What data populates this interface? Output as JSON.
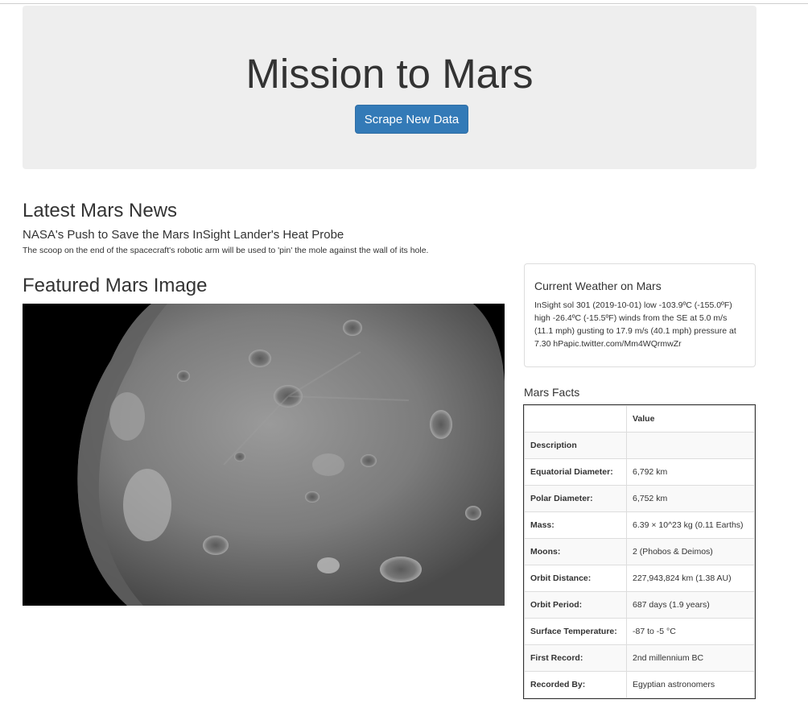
{
  "jumbotron": {
    "title": "Mission to Mars",
    "button_label": "Scrape New Data",
    "button_color": "#337ab7"
  },
  "news": {
    "heading": "Latest Mars News",
    "title": "NASA's Push to Save the Mars InSight Lander's Heat Probe",
    "teaser": "The scoop on the end of the spacecraft's robotic arm will be used to 'pin' the mole against the wall of its hole."
  },
  "featured": {
    "heading": "Featured Mars Image"
  },
  "weather": {
    "title": "Current Weather on Mars",
    "text": "InSight sol 301 (2019-10-01) low -103.9ºC (-155.0ºF) high -26.4ºC (-15.5ºF) winds from the SE at 5.0 m/s (11.1 mph) gusting to 17.9 m/s (40.1 mph) pressure at 7.30 hPapic.twitter.com/Mm4WQrmwZr"
  },
  "facts": {
    "heading": "Mars Facts",
    "header_label": "",
    "header_value": "Value",
    "rows": [
      {
        "label": "Description",
        "value": ""
      },
      {
        "label": "Equatorial Diameter:",
        "value": "6,792 km"
      },
      {
        "label": "Polar Diameter:",
        "value": "6,752 km"
      },
      {
        "label": "Mass:",
        "value": "6.39 × 10^23 kg (0.11 Earths)"
      },
      {
        "label": "Moons:",
        "value": "2 (Phobos & Deimos)"
      },
      {
        "label": "Orbit Distance:",
        "value": "227,943,824 km (1.38 AU)"
      },
      {
        "label": "Orbit Period:",
        "value": "687 days (1.9 years)"
      },
      {
        "label": "Surface Temperature:",
        "value": "-87 to -5 °C"
      },
      {
        "label": "First Record:",
        "value": "2nd millennium BC"
      },
      {
        "label": "Recorded By:",
        "value": "Egyptian astronomers"
      }
    ]
  }
}
